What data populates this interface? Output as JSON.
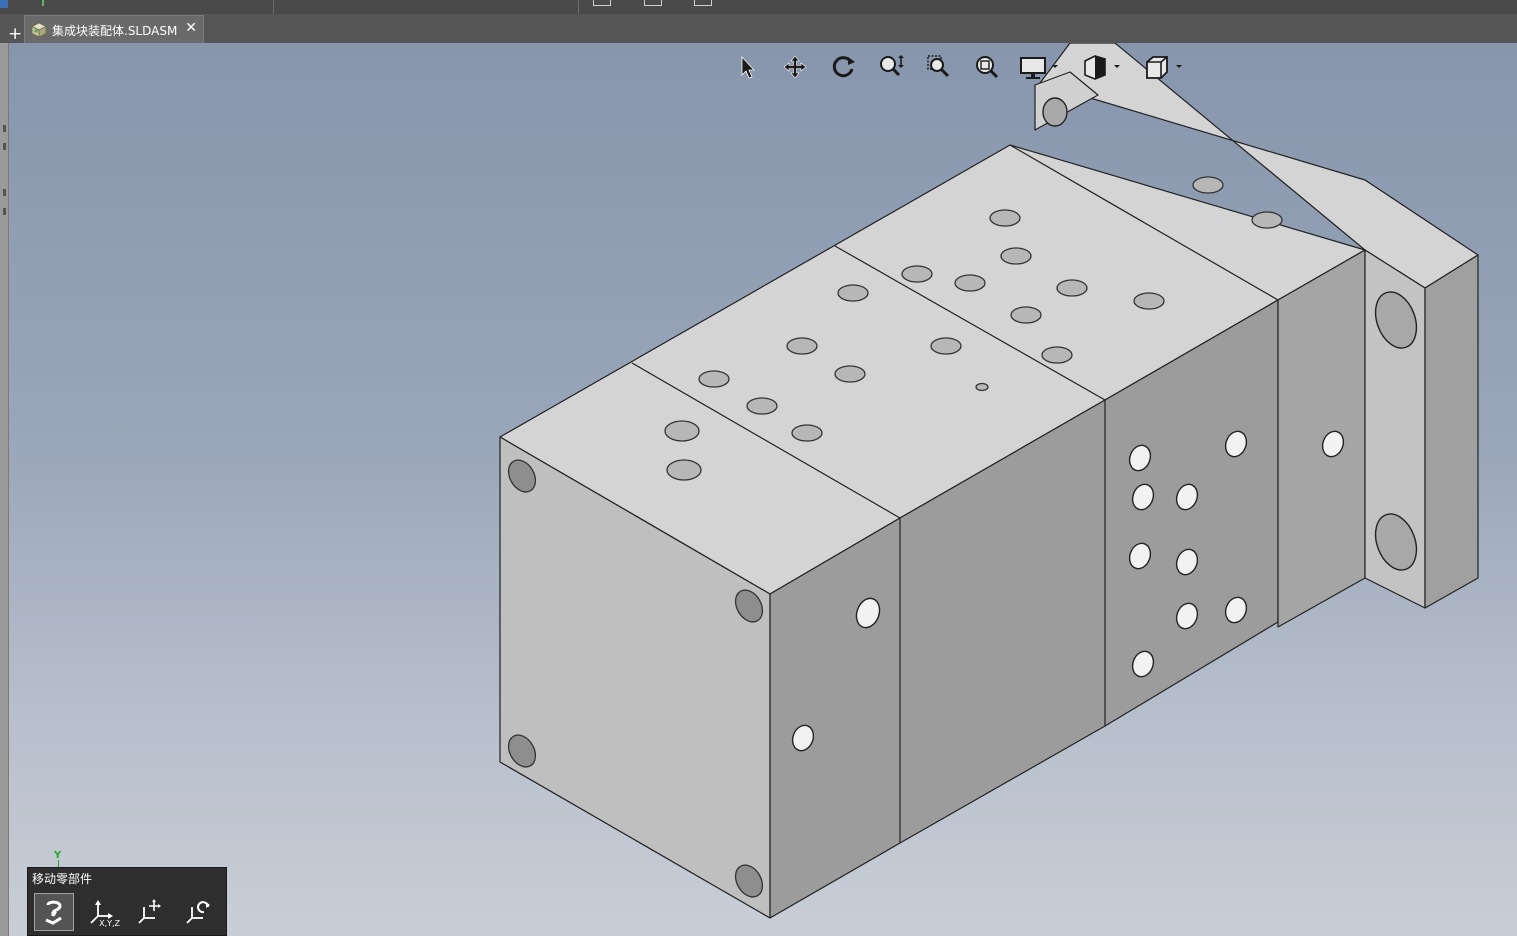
{
  "tabs": [
    {
      "label": "集成块装配体.SLDASM",
      "icon": "assembly-icon",
      "active": true
    }
  ],
  "new_tab_label": "+",
  "close_label": "✕",
  "view_toolbar": {
    "tools": [
      {
        "name": "select-icon"
      },
      {
        "name": "pan-icon"
      },
      {
        "name": "rotate-icon"
      },
      {
        "name": "zoom-in-out-icon"
      },
      {
        "name": "zoom-to-area-icon"
      },
      {
        "name": "zoom-to-fit-icon"
      },
      {
        "name": "display-style-icon",
        "dropdown": true
      },
      {
        "name": "section-view-icon",
        "dropdown": true
      },
      {
        "name": "view-orientation-icon",
        "dropdown": true
      }
    ]
  },
  "triad": {
    "axis_label": "Y",
    "color": "#1faa1f"
  },
  "move_panel": {
    "title": "移动零部件",
    "buttons": [
      {
        "name": "free-drag-icon",
        "active": true,
        "sub": ""
      },
      {
        "name": "move-xyz-icon",
        "active": false,
        "sub": "X,Y,Z"
      },
      {
        "name": "move-delta-icon",
        "active": false,
        "sub": ""
      },
      {
        "name": "rotate-component-icon",
        "active": false,
        "sub": ""
      }
    ]
  },
  "colors": {
    "viewport_top": "#8796ad",
    "viewport_bottom": "#c9ced6",
    "part_top": "#d4d4d4",
    "part_front": "#bdbdbd",
    "part_side": "#9b9b9b"
  }
}
